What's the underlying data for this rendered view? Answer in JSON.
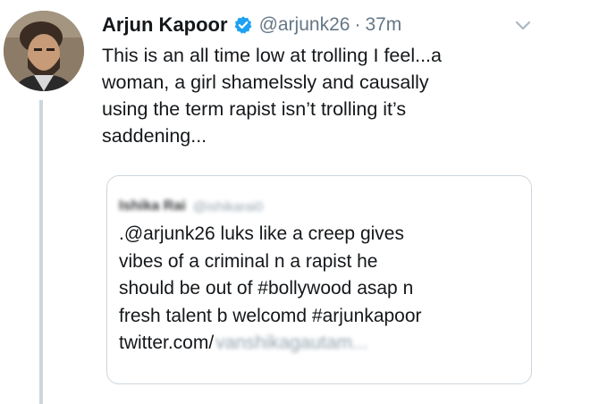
{
  "tweet": {
    "display_name": "Arjun Kapoor",
    "handle": "@arjunk26",
    "separator": "·",
    "time": "37m",
    "verified_icon": "verified-badge-icon",
    "menu_icon": "chevron-down-icon",
    "text_lines": [
      "This is an all time low at trolling I feel...a",
      "woman, a girl shamelssly and causally",
      "using the term rapist isn’t trolling it’s",
      "saddening..."
    ]
  },
  "quoted_tweet": {
    "display_name": "Ishika Rai",
    "handle": "@ishikarai0",
    "text_lines": [
      ".@arjunk26 luks like a creep gives",
      "vibes of a criminal n a rapist he",
      "should be out of #bollywood asap n",
      "fresh talent b welcomd #arjunkapoor"
    ],
    "link_prefix": "twitter.com/",
    "link_blurred": "vanshikagautam..."
  },
  "colors": {
    "text_primary": "#14171a",
    "text_secondary": "#657786",
    "verified_blue": "#1da1f2",
    "border": "#ccd6dd"
  }
}
